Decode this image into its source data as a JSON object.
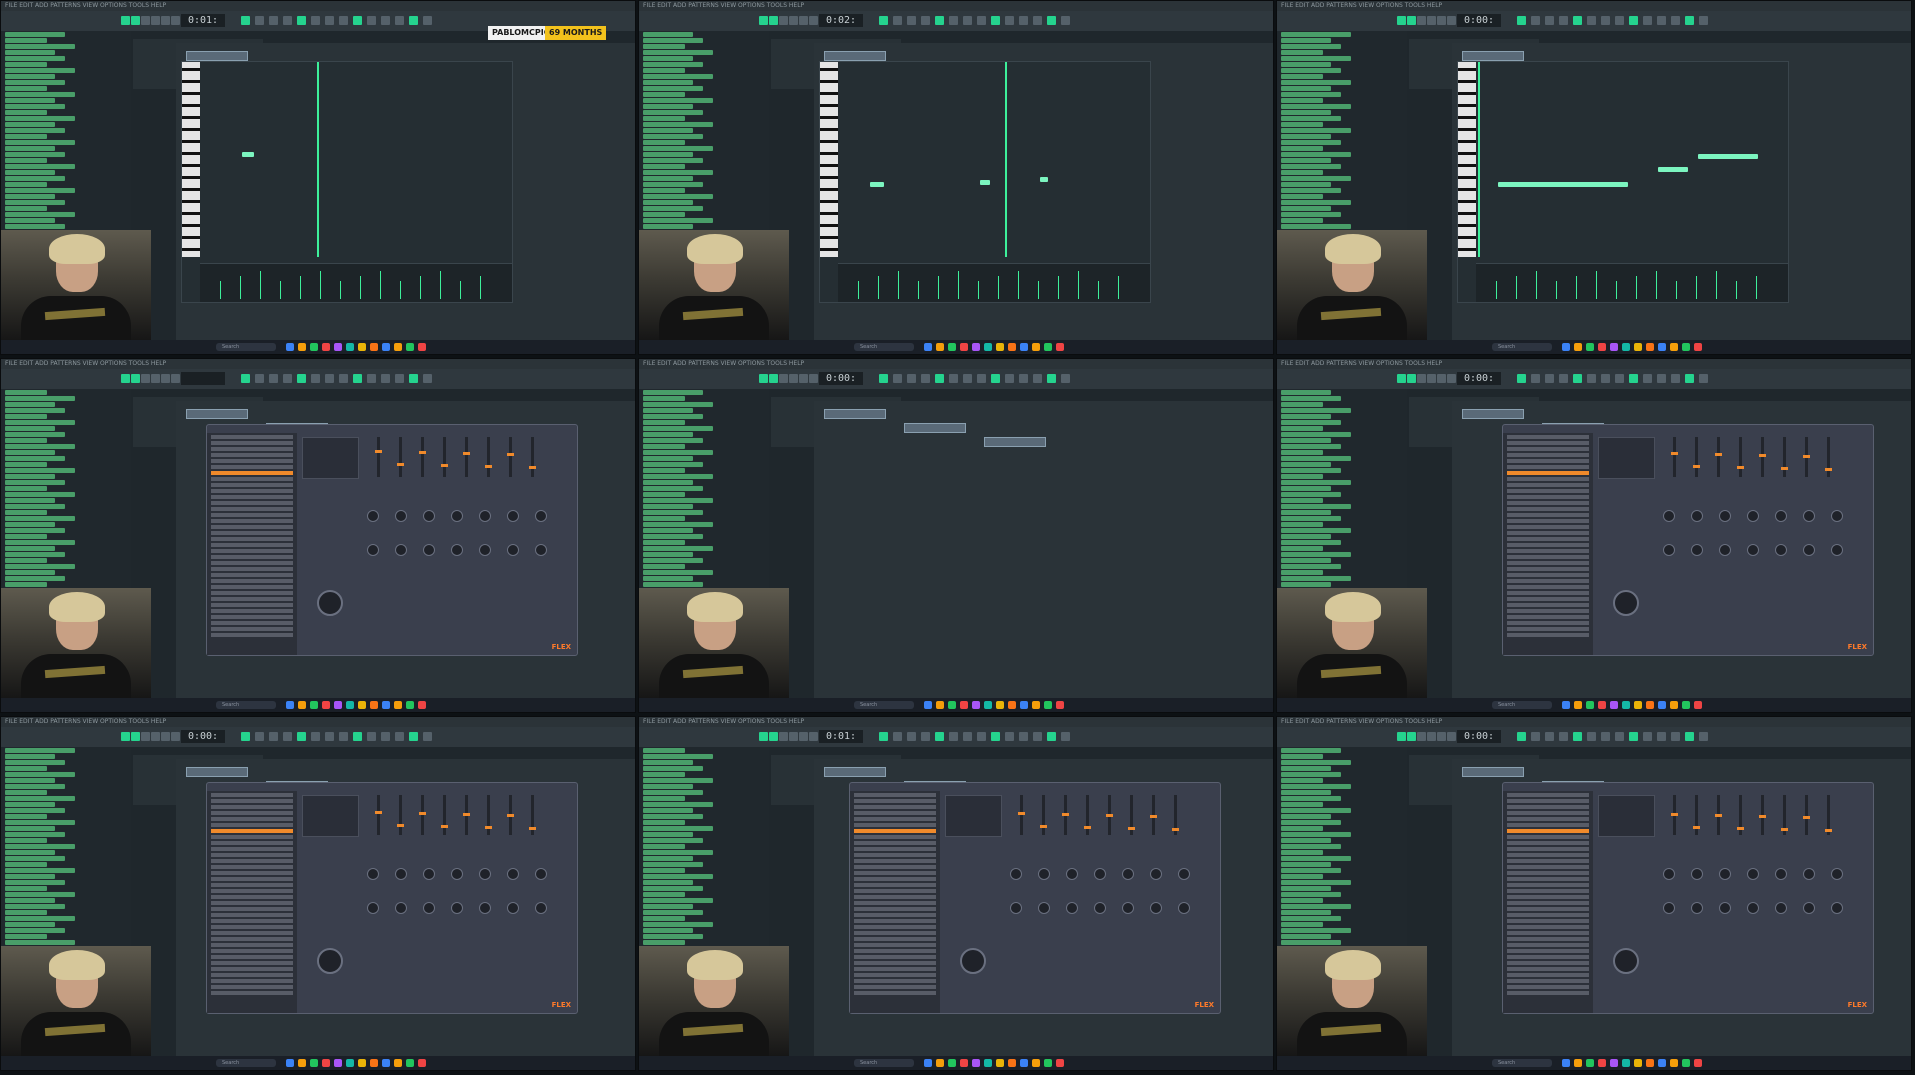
{
  "overlay": {
    "subscriber_name": "PABLOMCPICKLE",
    "subscriber_months": "69 MONTHS"
  },
  "app": {
    "menu": "FILE  EDIT  ADD  PATTERNS  VIEW  OPTIONS  TOOLS  HELP"
  },
  "taskbar": {
    "search_placeholder": "Search"
  },
  "plugin": {
    "name": "FLEX"
  },
  "colors": {
    "accent": "#3df09b",
    "orange": "#f08a2b",
    "badge_yellow": "#f3c21c"
  },
  "tiles": [
    {
      "time": "0:01:",
      "view": "piano-roll"
    },
    {
      "time": "0:02:",
      "view": "piano-roll"
    },
    {
      "time": "0:00:",
      "view": "piano-roll"
    },
    {
      "time": "",
      "view": "flex"
    },
    {
      "time": "0:00:",
      "view": "playlist"
    },
    {
      "time": "0:00:",
      "view": "flex"
    },
    {
      "time": "0:00:",
      "view": "flex"
    },
    {
      "time": "0:01:",
      "view": "flex"
    },
    {
      "time": "0:00:",
      "view": "flex"
    }
  ]
}
